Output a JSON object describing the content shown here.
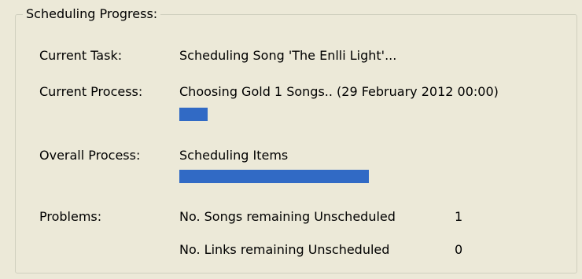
{
  "group": {
    "title": "Scheduling Progress:"
  },
  "current_task": {
    "label": "Current Task:",
    "value": "Scheduling Song 'The Enlli Light'..."
  },
  "current_process": {
    "label": "Current Process:",
    "value": "Choosing Gold 1 Songs.. (29 February 2012 00:00)",
    "progress_fraction": 0.15
  },
  "overall_process": {
    "label": "Overall Process:",
    "value": "Scheduling Items",
    "progress_fraction": 1.0
  },
  "problems": {
    "label": "Problems:",
    "rows": [
      {
        "label": "No. Songs remaining Unscheduled",
        "count": "1"
      },
      {
        "label": "No. Links remaining Unscheduled",
        "count": "0"
      }
    ]
  },
  "colors": {
    "progress": "#316ac5",
    "background": "#ece9d8"
  }
}
